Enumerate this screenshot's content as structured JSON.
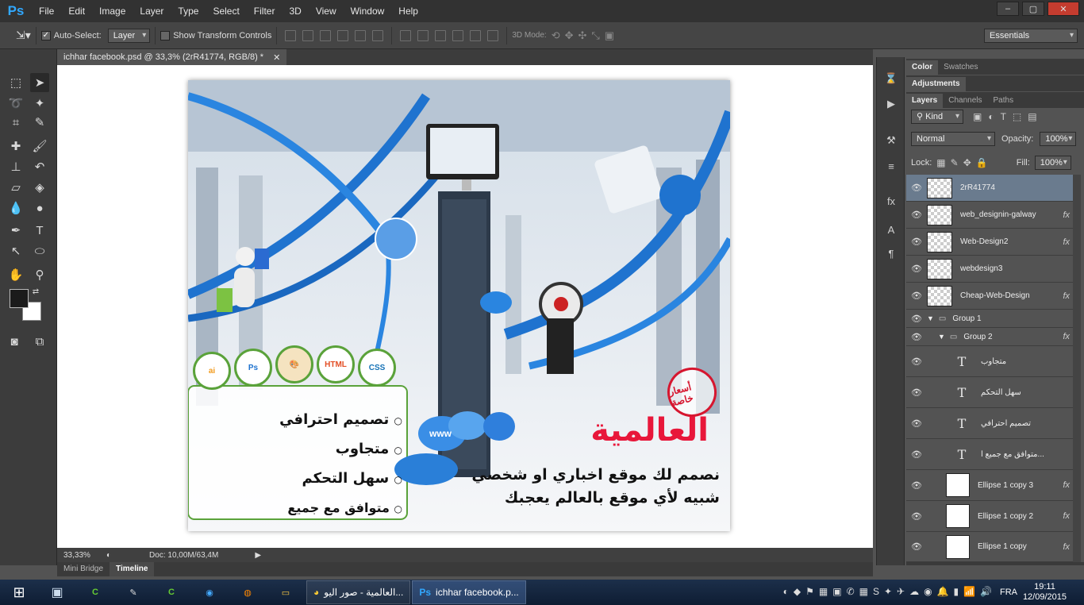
{
  "app": {
    "logo": "Ps",
    "menu": [
      "File",
      "Edit",
      "Image",
      "Layer",
      "Type",
      "Select",
      "Filter",
      "3D",
      "View",
      "Window",
      "Help"
    ],
    "window_controls": [
      "–",
      "▢",
      "✕"
    ]
  },
  "options": {
    "auto_select_label": "Auto-Select:",
    "auto_select_value": "Layer",
    "transform_label": "Show Transform Controls",
    "mode_label": "3D Mode:",
    "workspace": "Essentials"
  },
  "document": {
    "tab_title": "ichhar facebook.psd @ 33,3% (2rR41774, RGB/8) *",
    "zoom": "33,33%",
    "doc_info": "Doc: 10,00M/63,4M"
  },
  "bottom_tabs": [
    "Mini Bridge",
    "Timeline"
  ],
  "panels": {
    "top_tabs": [
      "Color",
      "Swatches"
    ],
    "adjustments_tab": "Adjustments",
    "layer_tabs": [
      "Layers",
      "Channels",
      "Paths"
    ],
    "filter_kind": "Kind",
    "blend_mode": "Normal",
    "opacity_label": "Opacity:",
    "opacity_value": "100%",
    "lock_label": "Lock:",
    "fill_label": "Fill:",
    "fill_value": "100%",
    "layers": [
      {
        "name": "2rR41774",
        "kind": "image",
        "fx": false,
        "selected": true
      },
      {
        "name": "web_designin-galway",
        "kind": "image",
        "fx": true
      },
      {
        "name": "Web-Design2",
        "kind": "image",
        "fx": true
      },
      {
        "name": "webdesign3",
        "kind": "image",
        "fx": false
      },
      {
        "name": "Cheap-Web-Design",
        "kind": "image",
        "fx": true
      },
      {
        "name": "Group 1",
        "kind": "group",
        "fx": false
      },
      {
        "name": "Group 2",
        "kind": "group",
        "fx": true
      },
      {
        "name": "متجاوب",
        "kind": "text",
        "fx": false
      },
      {
        "name": "سهل التحكم",
        "kind": "text",
        "fx": false
      },
      {
        "name": "تصميم احترافي",
        "kind": "text",
        "fx": false
      },
      {
        "name": "متوافق مع جميع ا...",
        "kind": "text",
        "fx": false
      },
      {
        "name": "Ellipse 1 copy 3",
        "kind": "shape",
        "fx": true
      },
      {
        "name": "Ellipse 1 copy 2",
        "kind": "shape",
        "fx": true
      },
      {
        "name": "Ellipse 1 copy",
        "kind": "shape",
        "fx": true
      }
    ]
  },
  "artwork": {
    "features": [
      "تصميم احترافي",
      "متجاوب",
      "سهل التحكم",
      "متوافق مع جميع المتصفحات"
    ],
    "brand": "العالمية",
    "stamp": "أسعار خاصة",
    "tagline_1": "نصمم لك موقع اخباري او شخصي",
    "tagline_2": "شبيه لأي موقع بالعالم يعجبك",
    "badges": [
      "ai",
      "Ps",
      "HTML",
      "CSS"
    ],
    "www_label": "www"
  },
  "taskbar": {
    "apps": [
      {
        "label": "العالمية - صور اليو...",
        "icon": "chrome-icon"
      },
      {
        "label": "ichhar facebook.p...",
        "icon": "photoshop-icon"
      }
    ],
    "lang": "FRA",
    "time": "19:11",
    "date": "12/09/2015"
  },
  "colors": {
    "ps_blue": "#31a8ff",
    "brand_red": "#e8173a",
    "ribbon_blue": "#1f73cf",
    "badge_green": "#5aa23a"
  }
}
